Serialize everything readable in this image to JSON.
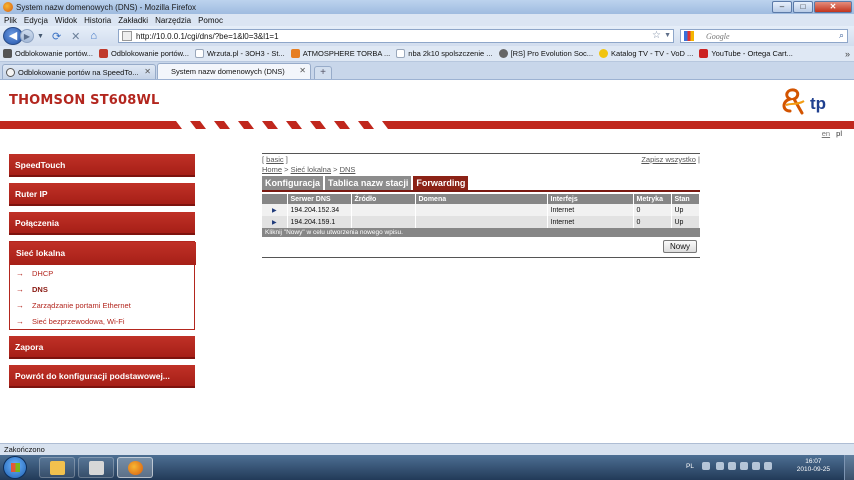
{
  "window": {
    "title": "System nazw domenowych (DNS) - Mozilla Firefox",
    "min": "–",
    "max": "□",
    "close": "✕"
  },
  "menu": [
    "Plik",
    "Edycja",
    "Widok",
    "Historia",
    "Zakładki",
    "Narzędzia",
    "Pomoc"
  ],
  "nav": {
    "url": "http://10.0.0.1/cgi/dns/?be=1&l0=3&l1=1",
    "search_placeholder": "Google"
  },
  "bookmarks": [
    {
      "label": "Odblokowanie portów...",
      "color": "#555555"
    },
    {
      "label": "Odblokowanie portów...",
      "color": "#c0392b"
    },
    {
      "label": "Wrzuta.pl - 3OH3 - St...",
      "color": "#9aa8bb"
    },
    {
      "label": "ATMOSPHERE TORBA ...",
      "color": "#e67e22"
    },
    {
      "label": "nba 2k10 spolszczenie ...",
      "color": "#9aa8bb"
    },
    {
      "label": "[RS] Pro Evolution Soc...",
      "color": "#666666"
    },
    {
      "label": "Katalog TV - TV - VoD ...",
      "color": "#f1c40f"
    },
    {
      "label": "YouTube - Ortega Cart...",
      "color": "#cc2222"
    }
  ],
  "tabs": [
    {
      "label": "Odblokowanie portów na SpeedTo...",
      "active": false
    },
    {
      "label": "System nazw domenowych (DNS)",
      "active": true
    }
  ],
  "page": {
    "brand": "THOMSON ST608WL",
    "logo_text": "tp",
    "lang": [
      "en",
      "pl"
    ],
    "sidebar": {
      "speedtouch": "SpeedTouch",
      "ruter": "Ruter IP",
      "polaczenia": "Połączenia",
      "siec": "Sieć lokalna",
      "sub": [
        "DHCP",
        "DNS",
        "Zarządzanie portami Ethernet",
        "Sieć bezprzewodowa, Wi-Fi"
      ],
      "zapora": "Zapora",
      "powrot": "Powrót do konfiguracji podstawowej..."
    },
    "basic_link": "basic",
    "save_all": "Zapisz wszystko",
    "breadcrumb": [
      "Home",
      "Sieć lokalna",
      "DNS"
    ],
    "page_tabs": [
      "Konfiguracja",
      "Tablica nazw stacji",
      "Forwarding"
    ],
    "table": {
      "headers": [
        "",
        "Serwer DNS",
        "Źródło",
        "Domena",
        "Interfejs",
        "Metryka",
        "Stan"
      ],
      "rows": [
        [
          "▶",
          "194.204.152.34",
          "",
          "",
          "Internet",
          "0",
          "Up"
        ],
        [
          "▶",
          "194.204.159.1",
          "",
          "",
          "Internet",
          "0",
          "Up"
        ]
      ]
    },
    "hint": "Kliknij \"Nowy\" w celu utworzenia nowego wpisu.",
    "new_button": "Nowy"
  },
  "status": "Zakończono",
  "taskbar": {
    "lang": "PL",
    "time": "16:07",
    "date": "2010-09-25"
  },
  "colors": {
    "brand_red": "#b3261e",
    "tab_active": "#8c2216",
    "tab_inactive": "#8c8c8c"
  }
}
